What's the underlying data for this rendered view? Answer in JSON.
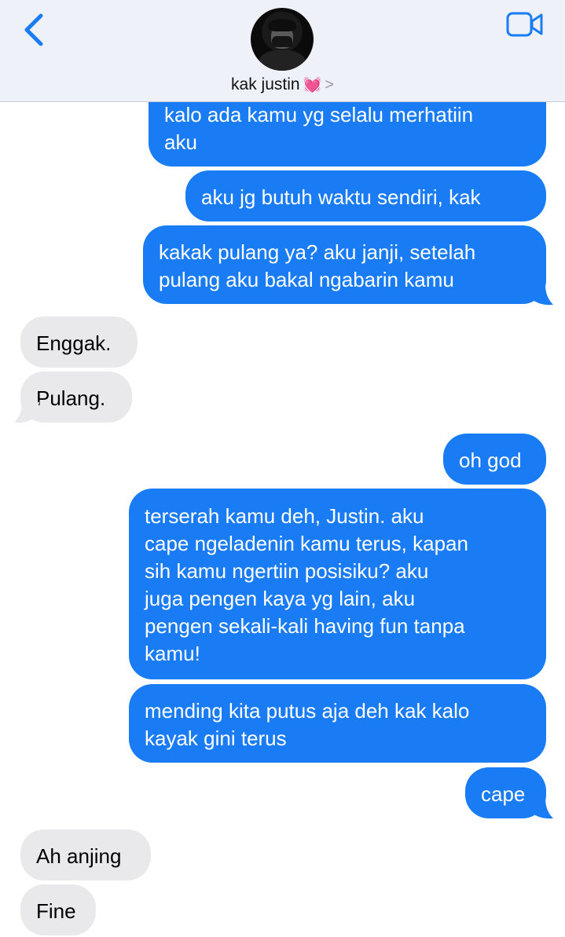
{
  "header": {
    "contact_name": "kak justin",
    "heart_emoji": "💓",
    "chevron": ">",
    "back_icon": "chevron-left-icon",
    "video_icon": "video-camera-icon",
    "accent_color": "#1a7cf5"
  },
  "messages": [
    {
      "direction": "outgoing",
      "text": "kalo ada kamu yg selalu merhatiin\naku"
    },
    {
      "direction": "outgoing",
      "text": "aku jg butuh waktu sendiri, kak"
    },
    {
      "direction": "outgoing",
      "text": "kakak pulang ya? aku janji, setelah\npulang aku bakal ngabarin kamu"
    },
    {
      "direction": "incoming",
      "text": "Enggak."
    },
    {
      "direction": "incoming",
      "text": "Pulang."
    },
    {
      "direction": "outgoing",
      "text": "oh god"
    },
    {
      "direction": "outgoing",
      "text": "terserah kamu deh, Justin. aku\ncape ngeladenin kamu terus, kapan\nsih kamu ngertiin posisiku? aku\njuga pengen kaya yg lain, aku\npengen sekali-kali having fun tanpa\nkamu!"
    },
    {
      "direction": "outgoing",
      "text": "mending kita putus aja deh kak kalo\nkayak gini terus"
    },
    {
      "direction": "outgoing",
      "text": "cape"
    },
    {
      "direction": "incoming",
      "text": "Ah anjing"
    },
    {
      "direction": "incoming",
      "text": "Fine"
    }
  ],
  "colors": {
    "outgoing_bubble": "#1a7cf5",
    "incoming_bubble": "#e9e9eb",
    "header_bg": "#eef2f8"
  }
}
